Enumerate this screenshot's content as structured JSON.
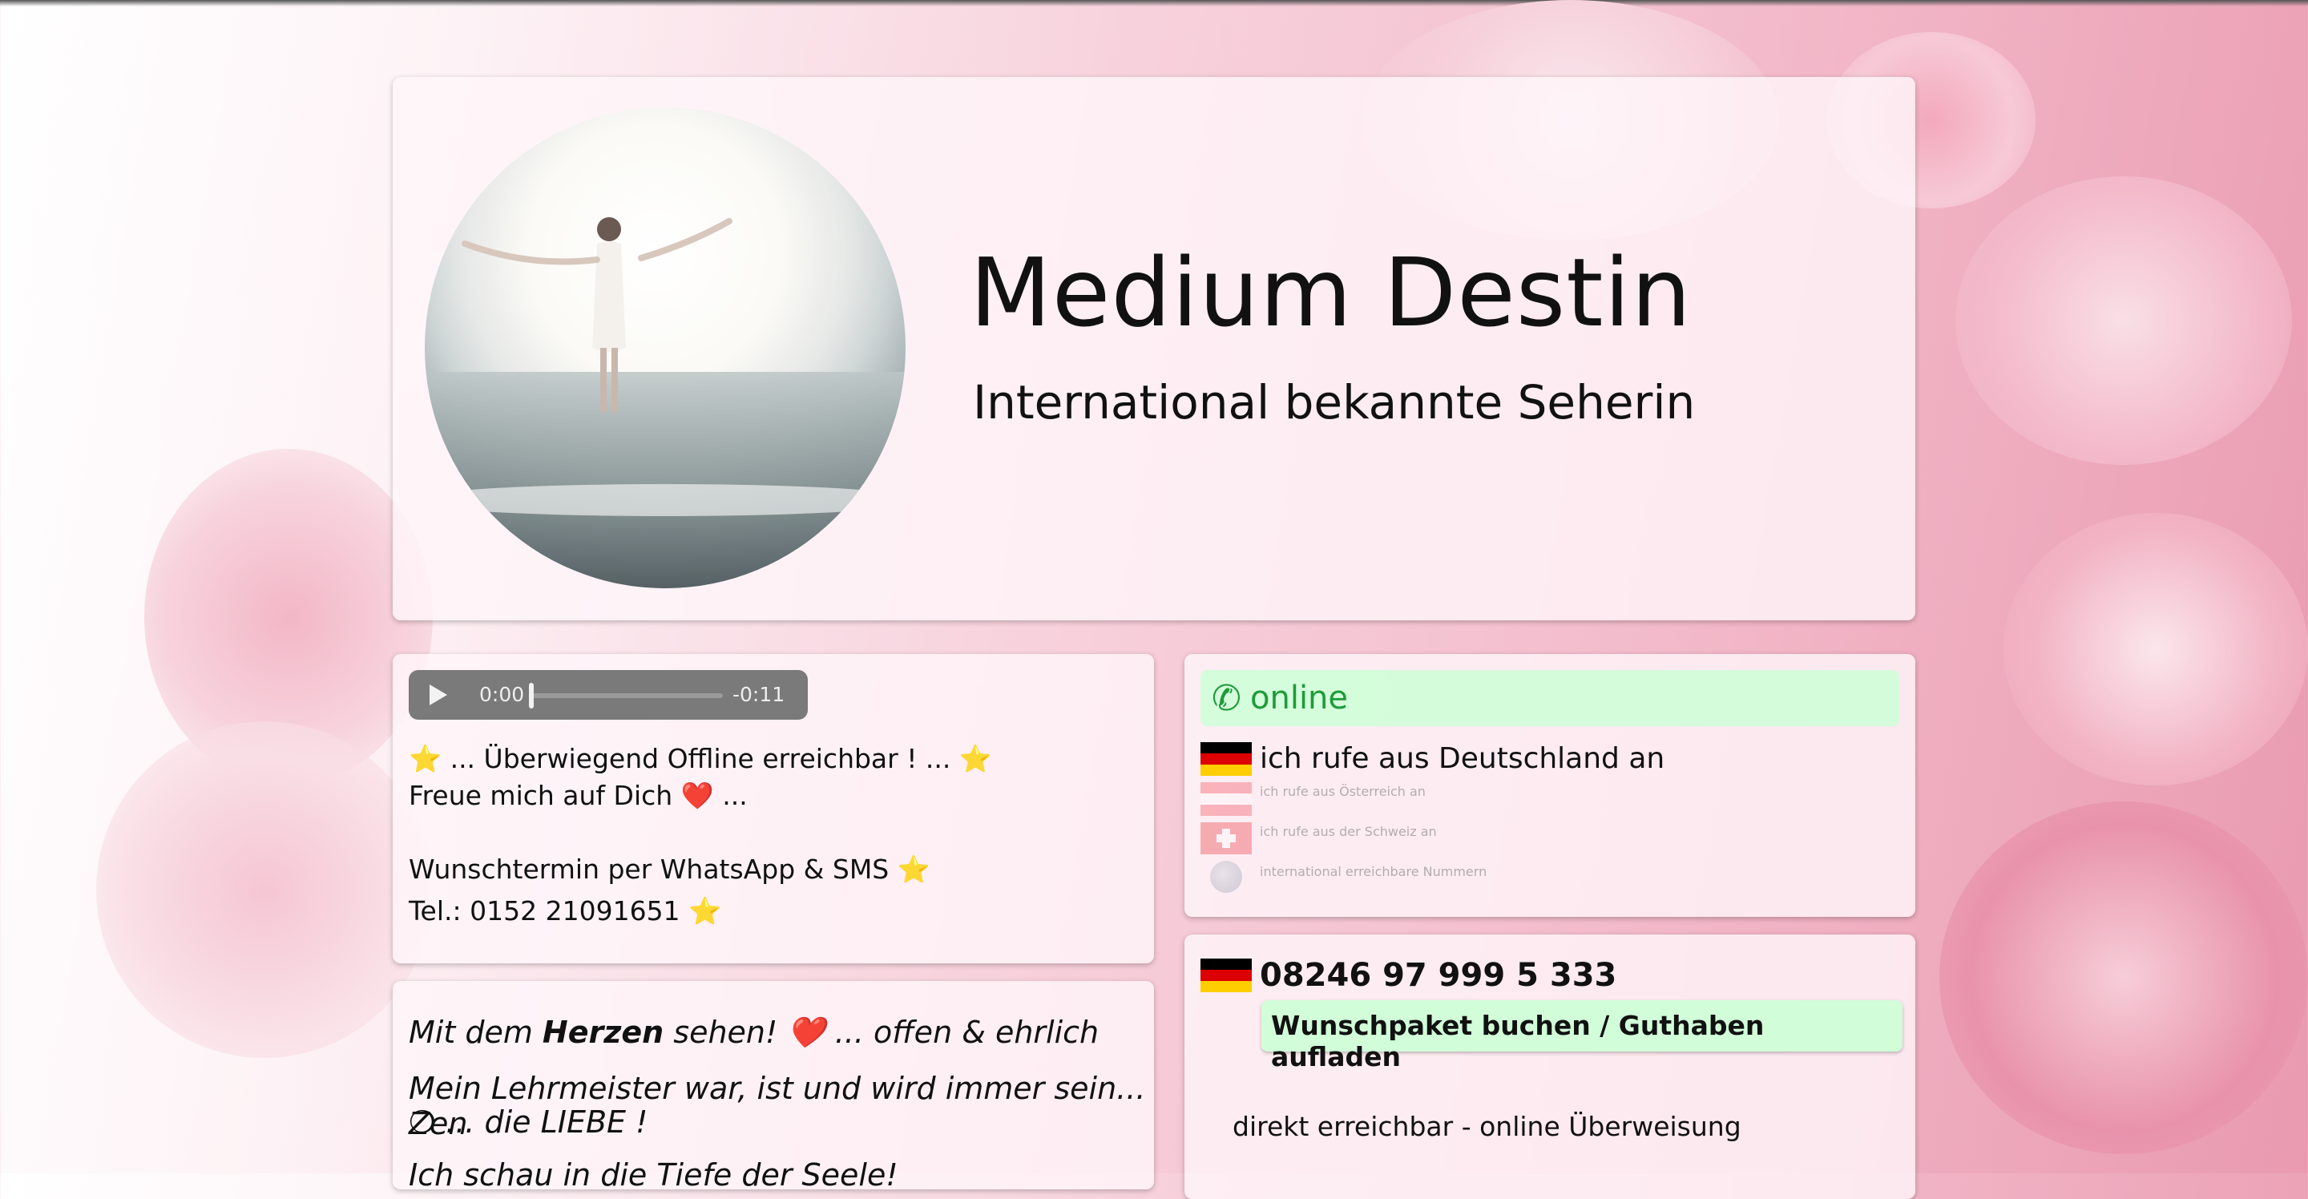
{
  "hero": {
    "title": "Medium Destin",
    "subtitle": "International bekannte Seherin"
  },
  "audio": {
    "current_time": "0:00",
    "remaining_time": "-0:11",
    "progress": 0
  },
  "info": {
    "line1": "⭐ ... Überwiegend Offline erreichbar ! ... ⭐",
    "line2": "Freue mich auf Dich ❤️ ...",
    "line3": "Wunschtermin per WhatsApp & SMS ⭐",
    "line4": "Tel.: 0152 21091651 ⭐"
  },
  "about": {
    "line1_pre": "Mit dem ",
    "line1_bold": "Herzen",
    "line1_post": " sehen! ❤️ ... offen & ehrlich",
    "line2": "Mein Lehrmeister war, ist und wird immer sein... Zen",
    "line3": "❍ ... die LIEBE !",
    "line4": "Ich schau in die Tiefe der Seele!"
  },
  "status": {
    "label": "online",
    "icon": "phone-icon",
    "color": "#1e9b3a",
    "background": "#ccffd6"
  },
  "countries": {
    "de": "ich rufe aus Deutschland an",
    "at": "ich rufe aus Österreich an",
    "ch": "ich rufe aus der Schweiz an",
    "intl": "international erreichbare Nummern"
  },
  "phone": {
    "number": "08246 97 999 5 333",
    "book_label": "Wunschpaket buchen / Guthaben aufladen",
    "direct_label": "direkt erreichbar - online Überweisung"
  }
}
